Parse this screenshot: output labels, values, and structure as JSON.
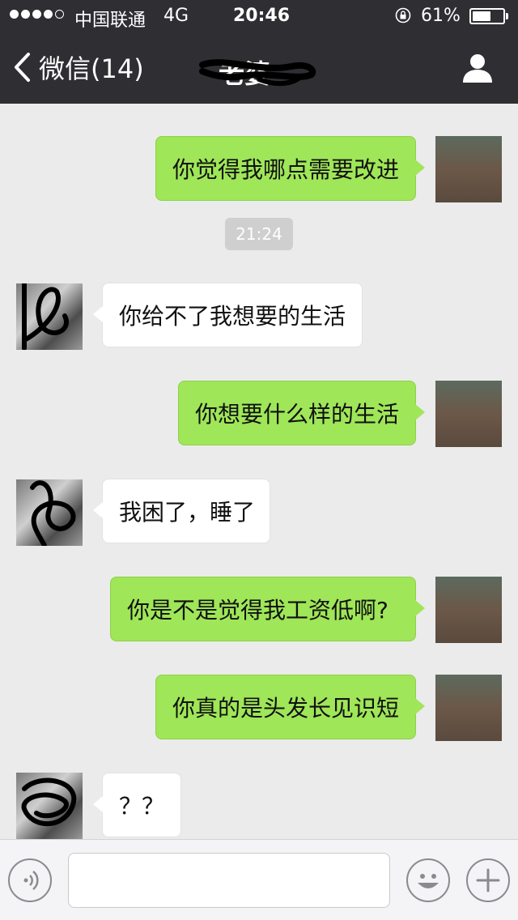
{
  "status_bar": {
    "signal_bars_filled": 4,
    "signal_bars_total": 5,
    "carrier": "中国联通",
    "network": "4G",
    "time": "20:46",
    "battery_percent": "61%",
    "battery_level": 0.61
  },
  "nav": {
    "back_label": "微信(14)",
    "title": "老婆"
  },
  "chat": {
    "timestamp": "21:24",
    "messages": [
      {
        "side": "self",
        "text": "你觉得我哪点需要改进"
      },
      {
        "side": "other",
        "text": "你给不了我想要的生活"
      },
      {
        "side": "self",
        "text": "你想要什么样的生活"
      },
      {
        "side": "other",
        "text": "我困了，睡了"
      },
      {
        "side": "self",
        "text": "你是不是觉得我工资低啊?"
      },
      {
        "side": "self",
        "text": "你真的是头发长见识短"
      },
      {
        "side": "other",
        "text": "？？"
      }
    ]
  },
  "input_bar": {
    "text_value": ""
  },
  "icons": {
    "back": "chevron-left-icon",
    "profile": "person-icon",
    "lock": "rotation-lock-icon",
    "voice": "voice-icon",
    "emoji": "emoji-icon",
    "plus": "plus-icon"
  },
  "colors": {
    "nav_bg": "#2e2e33",
    "chat_bg": "#ebebeb",
    "self_bubble": "#9fe658",
    "other_bubble": "#ffffff"
  }
}
